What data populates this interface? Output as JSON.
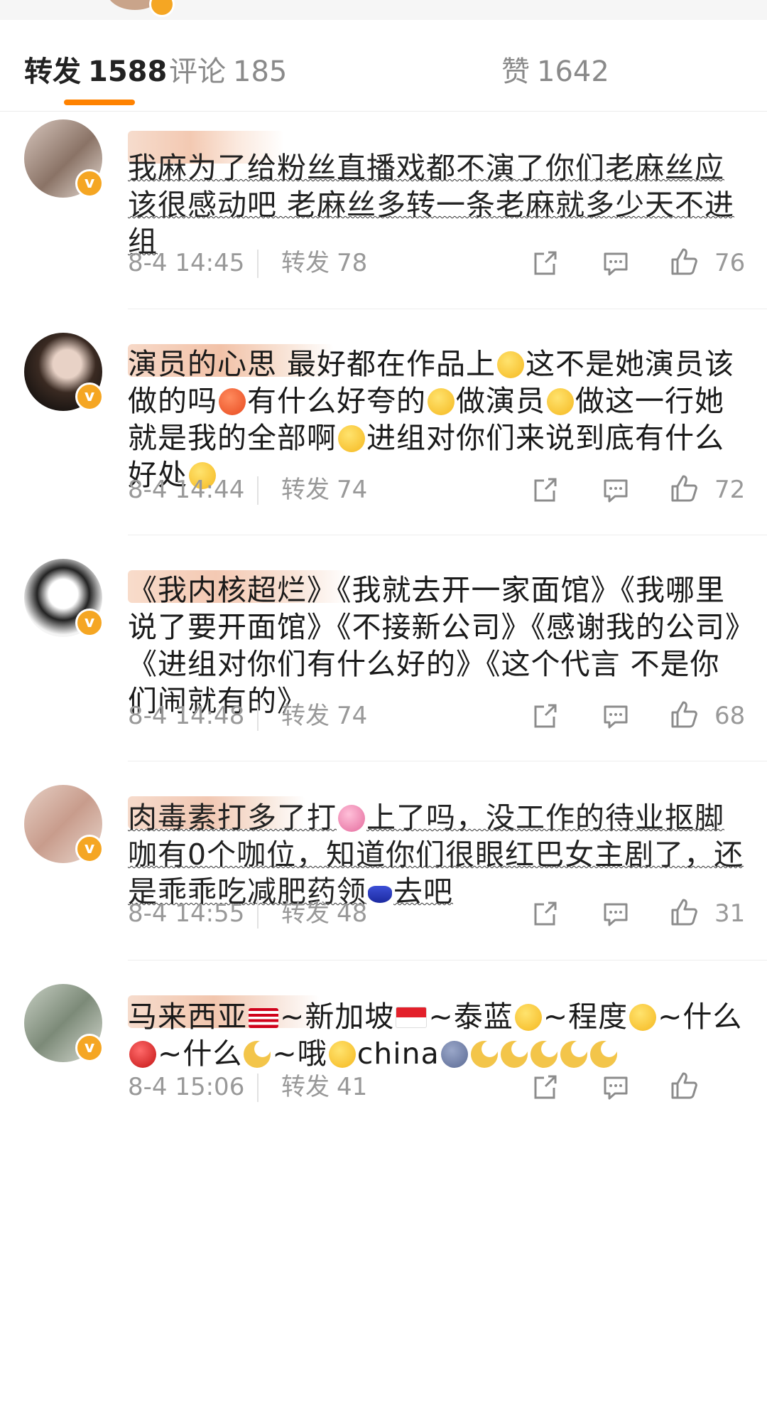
{
  "tabs": {
    "repost": {
      "label": "转发",
      "count": "1588"
    },
    "comment": {
      "label": "评论",
      "count": "185"
    },
    "like": {
      "label": "赞",
      "count": "1642"
    }
  },
  "comments": [
    {
      "text": "我麻为了给粉丝直播戏都不演了你们老麻丝应该很感动吧 老麻丝多转一条老麻就多少天不进组",
      "time": "8-4 14:45",
      "repost_label": "转发",
      "repost_count": "78",
      "likes": "76"
    },
    {
      "text_parts": [
        "演员的心思 最好都在作品上",
        "这不是她演员该做的吗",
        "有什么好夸的",
        "做演员",
        "做这一行她就是我的全部啊",
        "进组对你们来说到底有什么好处"
      ],
      "time": "8-4 14:44",
      "repost_label": "转发",
      "repost_count": "74",
      "likes": "72"
    },
    {
      "text": "《我内核超烂》《我就去开一家面馆》《我哪里说了要开面馆》《不接新公司》《感谢我的公司》《进组对你们有什么好的》《这个代言 不是你们闹就有的》",
      "time": "8-4 14:48",
      "repost_label": "转发",
      "repost_count": "74",
      "likes": "68"
    },
    {
      "text_parts": [
        "肉毒素打多了打",
        "上了吗，没工作的待业抠脚咖有0个咖位，知道你们很眼红巴女主剧了，还是乖乖吃减肥药领",
        "去吧"
      ],
      "time": "8-4 14:55",
      "repost_label": "转发",
      "repost_count": "48",
      "likes": "31"
    },
    {
      "text_parts": [
        "马来西亚",
        "~新加坡",
        "~泰蓝",
        "~程度",
        "~什么",
        "~什么",
        "~哦",
        "china"
      ],
      "time": "8-4 15:06",
      "repost_label": "转发",
      "repost_count": "41"
    }
  ],
  "colors": {
    "accent": "#ff8200",
    "vip": "#f5a623",
    "meta": "#999999"
  },
  "icons": [
    "share-icon",
    "comment-icon",
    "thumb-up-icon",
    "vip-badge-icon"
  ]
}
